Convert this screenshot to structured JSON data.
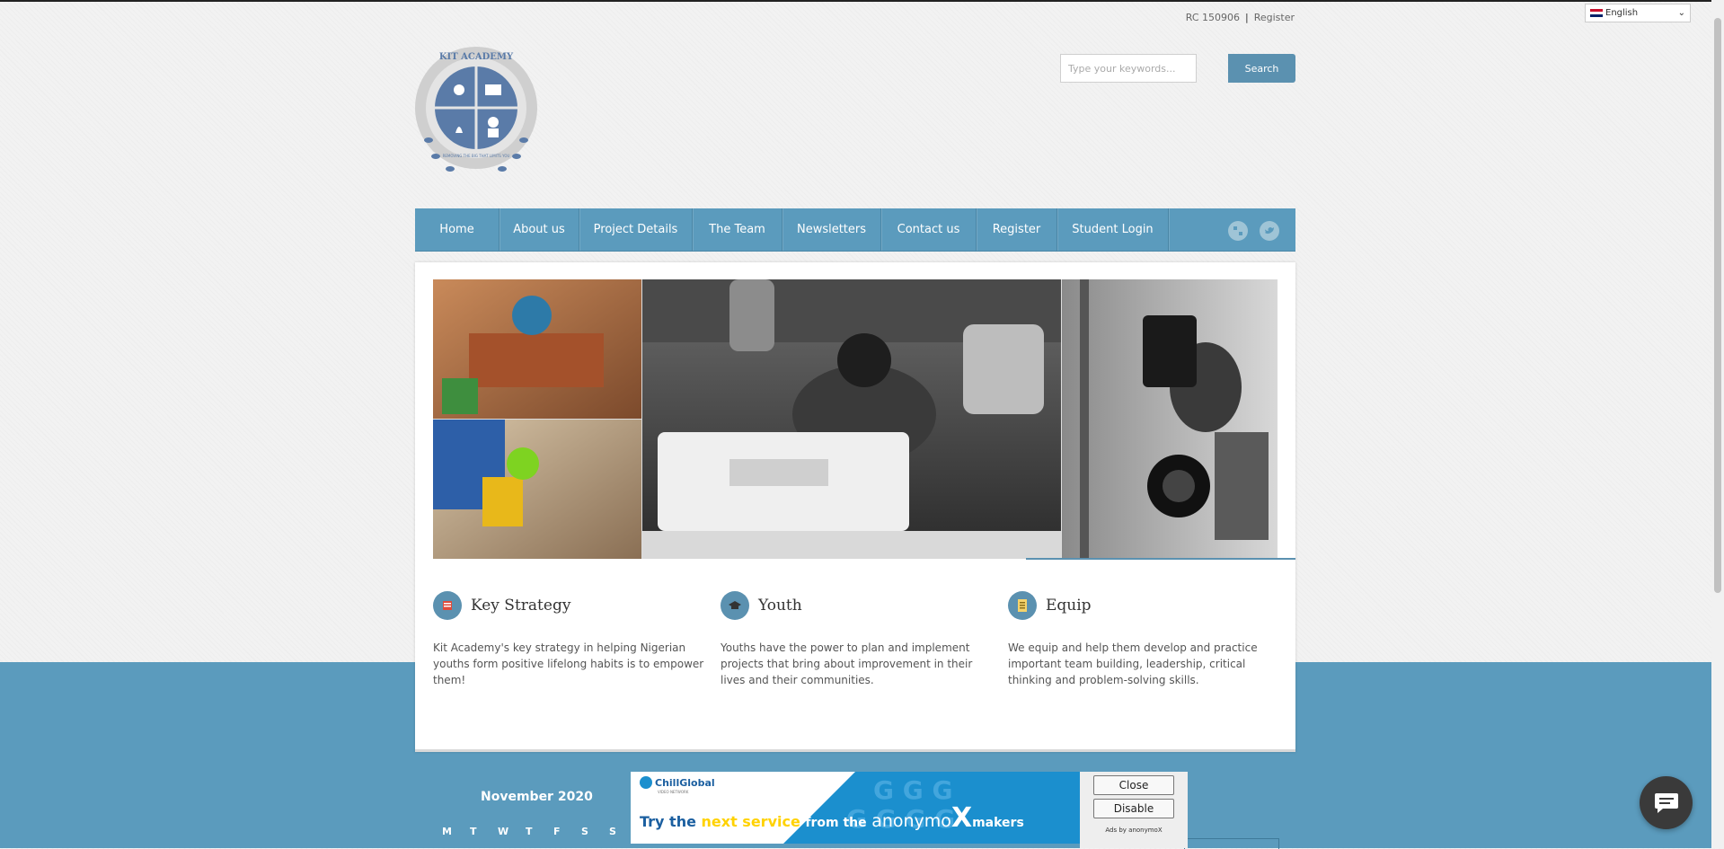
{
  "top_bar": {
    "rc": "RC 150906",
    "separator": "|",
    "register": "Register"
  },
  "language": {
    "selected": "English"
  },
  "logo": {
    "text_top": "KIT ACADEMY",
    "text_bottom": "REMOVING THE BIG THAT LIMITS YOU"
  },
  "search": {
    "placeholder": "Type your keywords...",
    "button": "Search"
  },
  "nav": [
    "Home",
    "About us",
    "Project Details",
    "The Team",
    "Newsletters",
    "Contact us",
    "Register",
    "Student Login"
  ],
  "features": [
    {
      "title": "Key Strategy",
      "icon": "book-icon",
      "desc": "Kit Academy's key strategy in helping Nigerian youths form positive lifelong habits is to empower them!"
    },
    {
      "title": "Youth",
      "icon": "graduation-cap-icon",
      "desc": "Youths have the power to plan and implement projects that bring about improvement in their lives and their communities."
    },
    {
      "title": "Equip",
      "icon": "notebook-icon",
      "desc": "We equip and help them develop and practice important team building, leadership, critical thinking and problem-solving skills."
    }
  ],
  "calendar": {
    "title": "November 2020",
    "days": [
      "M",
      "T",
      "W",
      "T",
      "F",
      "S",
      "S"
    ]
  },
  "ad": {
    "brand": "ChillGlobal",
    "brand_sub": "VIDEO NETWORK",
    "tagline_1": "Try the",
    "tagline_2": "next service",
    "tagline_3": "from the",
    "tagline_4": "anonymo",
    "tagline_5": "X",
    "tagline_6": "makers",
    "close": "Close",
    "disable": "Disable",
    "small": "Ads by anonymoX"
  },
  "colors": {
    "accent": "#5b9bbd",
    "button": "#5b91b0",
    "ad_blue": "#1b8fce",
    "ad_yellow": "#ffd200"
  }
}
